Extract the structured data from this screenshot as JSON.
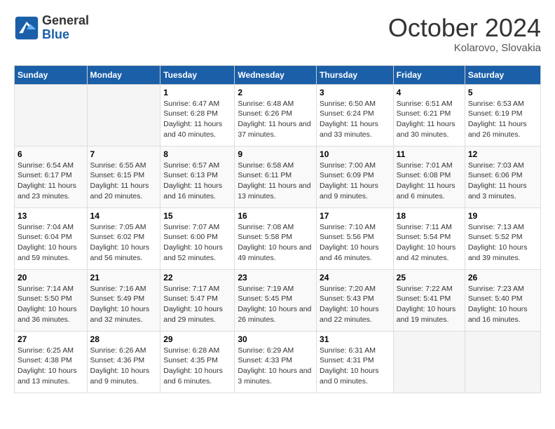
{
  "header": {
    "logo_line1": "General",
    "logo_line2": "Blue",
    "month": "October 2024",
    "location": "Kolarovo, Slovakia"
  },
  "weekdays": [
    "Sunday",
    "Monday",
    "Tuesday",
    "Wednesday",
    "Thursday",
    "Friday",
    "Saturday"
  ],
  "weeks": [
    [
      {
        "day": "",
        "info": ""
      },
      {
        "day": "",
        "info": ""
      },
      {
        "day": "1",
        "info": "Sunrise: 6:47 AM\nSunset: 6:28 PM\nDaylight: 11 hours and 40 minutes."
      },
      {
        "day": "2",
        "info": "Sunrise: 6:48 AM\nSunset: 6:26 PM\nDaylight: 11 hours and 37 minutes."
      },
      {
        "day": "3",
        "info": "Sunrise: 6:50 AM\nSunset: 6:24 PM\nDaylight: 11 hours and 33 minutes."
      },
      {
        "day": "4",
        "info": "Sunrise: 6:51 AM\nSunset: 6:21 PM\nDaylight: 11 hours and 30 minutes."
      },
      {
        "day": "5",
        "info": "Sunrise: 6:53 AM\nSunset: 6:19 PM\nDaylight: 11 hours and 26 minutes."
      }
    ],
    [
      {
        "day": "6",
        "info": "Sunrise: 6:54 AM\nSunset: 6:17 PM\nDaylight: 11 hours and 23 minutes."
      },
      {
        "day": "7",
        "info": "Sunrise: 6:55 AM\nSunset: 6:15 PM\nDaylight: 11 hours and 20 minutes."
      },
      {
        "day": "8",
        "info": "Sunrise: 6:57 AM\nSunset: 6:13 PM\nDaylight: 11 hours and 16 minutes."
      },
      {
        "day": "9",
        "info": "Sunrise: 6:58 AM\nSunset: 6:11 PM\nDaylight: 11 hours and 13 minutes."
      },
      {
        "day": "10",
        "info": "Sunrise: 7:00 AM\nSunset: 6:09 PM\nDaylight: 11 hours and 9 minutes."
      },
      {
        "day": "11",
        "info": "Sunrise: 7:01 AM\nSunset: 6:08 PM\nDaylight: 11 hours and 6 minutes."
      },
      {
        "day": "12",
        "info": "Sunrise: 7:03 AM\nSunset: 6:06 PM\nDaylight: 11 hours and 3 minutes."
      }
    ],
    [
      {
        "day": "13",
        "info": "Sunrise: 7:04 AM\nSunset: 6:04 PM\nDaylight: 10 hours and 59 minutes."
      },
      {
        "day": "14",
        "info": "Sunrise: 7:05 AM\nSunset: 6:02 PM\nDaylight: 10 hours and 56 minutes."
      },
      {
        "day": "15",
        "info": "Sunrise: 7:07 AM\nSunset: 6:00 PM\nDaylight: 10 hours and 52 minutes."
      },
      {
        "day": "16",
        "info": "Sunrise: 7:08 AM\nSunset: 5:58 PM\nDaylight: 10 hours and 49 minutes."
      },
      {
        "day": "17",
        "info": "Sunrise: 7:10 AM\nSunset: 5:56 PM\nDaylight: 10 hours and 46 minutes."
      },
      {
        "day": "18",
        "info": "Sunrise: 7:11 AM\nSunset: 5:54 PM\nDaylight: 10 hours and 42 minutes."
      },
      {
        "day": "19",
        "info": "Sunrise: 7:13 AM\nSunset: 5:52 PM\nDaylight: 10 hours and 39 minutes."
      }
    ],
    [
      {
        "day": "20",
        "info": "Sunrise: 7:14 AM\nSunset: 5:50 PM\nDaylight: 10 hours and 36 minutes."
      },
      {
        "day": "21",
        "info": "Sunrise: 7:16 AM\nSunset: 5:49 PM\nDaylight: 10 hours and 32 minutes."
      },
      {
        "day": "22",
        "info": "Sunrise: 7:17 AM\nSunset: 5:47 PM\nDaylight: 10 hours and 29 minutes."
      },
      {
        "day": "23",
        "info": "Sunrise: 7:19 AM\nSunset: 5:45 PM\nDaylight: 10 hours and 26 minutes."
      },
      {
        "day": "24",
        "info": "Sunrise: 7:20 AM\nSunset: 5:43 PM\nDaylight: 10 hours and 22 minutes."
      },
      {
        "day": "25",
        "info": "Sunrise: 7:22 AM\nSunset: 5:41 PM\nDaylight: 10 hours and 19 minutes."
      },
      {
        "day": "26",
        "info": "Sunrise: 7:23 AM\nSunset: 5:40 PM\nDaylight: 10 hours and 16 minutes."
      }
    ],
    [
      {
        "day": "27",
        "info": "Sunrise: 6:25 AM\nSunset: 4:38 PM\nDaylight: 10 hours and 13 minutes."
      },
      {
        "day": "28",
        "info": "Sunrise: 6:26 AM\nSunset: 4:36 PM\nDaylight: 10 hours and 9 minutes."
      },
      {
        "day": "29",
        "info": "Sunrise: 6:28 AM\nSunset: 4:35 PM\nDaylight: 10 hours and 6 minutes."
      },
      {
        "day": "30",
        "info": "Sunrise: 6:29 AM\nSunset: 4:33 PM\nDaylight: 10 hours and 3 minutes."
      },
      {
        "day": "31",
        "info": "Sunrise: 6:31 AM\nSunset: 4:31 PM\nDaylight: 10 hours and 0 minutes."
      },
      {
        "day": "",
        "info": ""
      },
      {
        "day": "",
        "info": ""
      }
    ]
  ]
}
